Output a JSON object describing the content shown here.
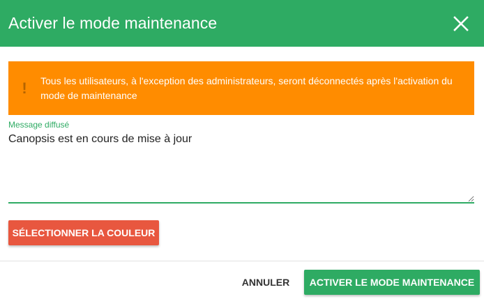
{
  "dialog": {
    "title": "Activer le mode maintenance",
    "close_icon": "close-icon"
  },
  "alert": {
    "icon": "warning-icon",
    "icon_glyph": "!",
    "message": "Tous les utilisateurs, à l'exception des administrateurs, seront déconnectés après l'activation du mode de maintenance",
    "color": "#ff8c00"
  },
  "message_field": {
    "label": "Message diffusé",
    "value": "Canopsis est en cours de mise à jour"
  },
  "buttons": {
    "select_color": "SÉLECTIONNER LA COULEUR",
    "cancel": "ANNULER",
    "confirm": "ACTIVER LE MODE MAINTENANCE"
  },
  "colors": {
    "primary": "#2eab63",
    "warning": "#ff8c00",
    "color_button": "#e8573f"
  }
}
